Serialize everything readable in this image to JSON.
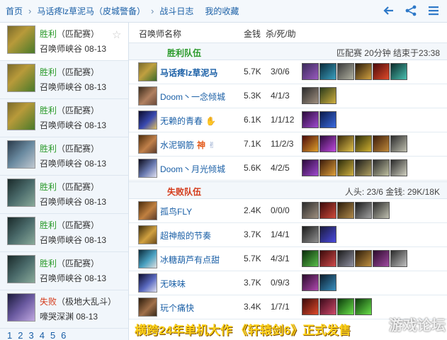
{
  "breadcrumb": [
    {
      "label": "首页"
    },
    {
      "label": "马话疼lz草泥马（皮城警备）"
    },
    {
      "label": "战斗日志"
    },
    {
      "label": "我的收藏"
    }
  ],
  "toolbar": {
    "back_icon": "back-arrow-icon",
    "share_icon": "share-icon",
    "menu_icon": "menu-icon"
  },
  "matches": [
    {
      "result": "胜利",
      "mode": "（匹配赛）",
      "map": "召唤师峡谷",
      "date": "08-13",
      "win": true
    },
    {
      "result": "胜利",
      "mode": "（匹配赛）",
      "map": "召唤师峡谷",
      "date": "08-13",
      "win": true
    },
    {
      "result": "胜利",
      "mode": "（匹配赛）",
      "map": "召唤师峡谷",
      "date": "08-13",
      "win": true
    },
    {
      "result": "胜利",
      "mode": "（匹配赛）",
      "map": "召唤师峡谷",
      "date": "08-13",
      "win": true
    },
    {
      "result": "胜利",
      "mode": "（匹配赛）",
      "map": "召唤师峡谷",
      "date": "08-13",
      "win": true
    },
    {
      "result": "胜利",
      "mode": "（匹配赛）",
      "map": "召唤师峡谷",
      "date": "08-13",
      "win": true
    },
    {
      "result": "胜利",
      "mode": "（匹配赛）",
      "map": "召唤师峡谷",
      "date": "08-13",
      "win": true
    },
    {
      "result": "失败",
      "mode": "（极地大乱斗）",
      "map": "嚎哭深渊",
      "date": "08-13",
      "win": false
    }
  ],
  "pager": [
    "1",
    "2",
    "3",
    "4",
    "5",
    "6"
  ],
  "columns": {
    "name": "召唤师名称",
    "gold": "金钱",
    "kda": "杀/死/助"
  },
  "win_team": {
    "label": "胜利队伍",
    "info": "匹配赛 20分钟 结束于23:38"
  },
  "lose_team": {
    "label": "失败队伍",
    "info": "人头: 23/6 金钱: 29K/18K"
  },
  "win_players": [
    {
      "name": "马话疼lz草泥马",
      "gold": "5.7K",
      "kda": "3/0/6"
    },
    {
      "name": "Doom丶一念倾城",
      "gold": "5.3K",
      "kda": "4/1/3"
    },
    {
      "name": "无赖的青春",
      "gold": "6.1K",
      "kda": "1/1/12"
    },
    {
      "name": "水泥钢筋",
      "gold": "7.1K",
      "kda": "11/2/3",
      "badge": "神"
    },
    {
      "name": "Doom丶月光倾城",
      "gold": "5.6K",
      "kda": "4/2/5"
    }
  ],
  "lose_players": [
    {
      "name": "孤鸟FLY",
      "gold": "2.4K",
      "kda": "0/0/0"
    },
    {
      "name": "超神般的节奏",
      "gold": "3.7K",
      "kda": "1/4/1"
    },
    {
      "name": "冰糖葫芦有点甜",
      "gold": "5.7K",
      "kda": "4/3/1"
    },
    {
      "name": "无味味",
      "gold": "3.7K",
      "kda": "0/9/3"
    },
    {
      "name": "玩个痛快",
      "gold": "3.4K",
      "kda": "1/7/1"
    }
  ],
  "banner": "横跨24年单机大作 《轩辕剑6》正式发售",
  "watermark": "游戏论坛"
}
